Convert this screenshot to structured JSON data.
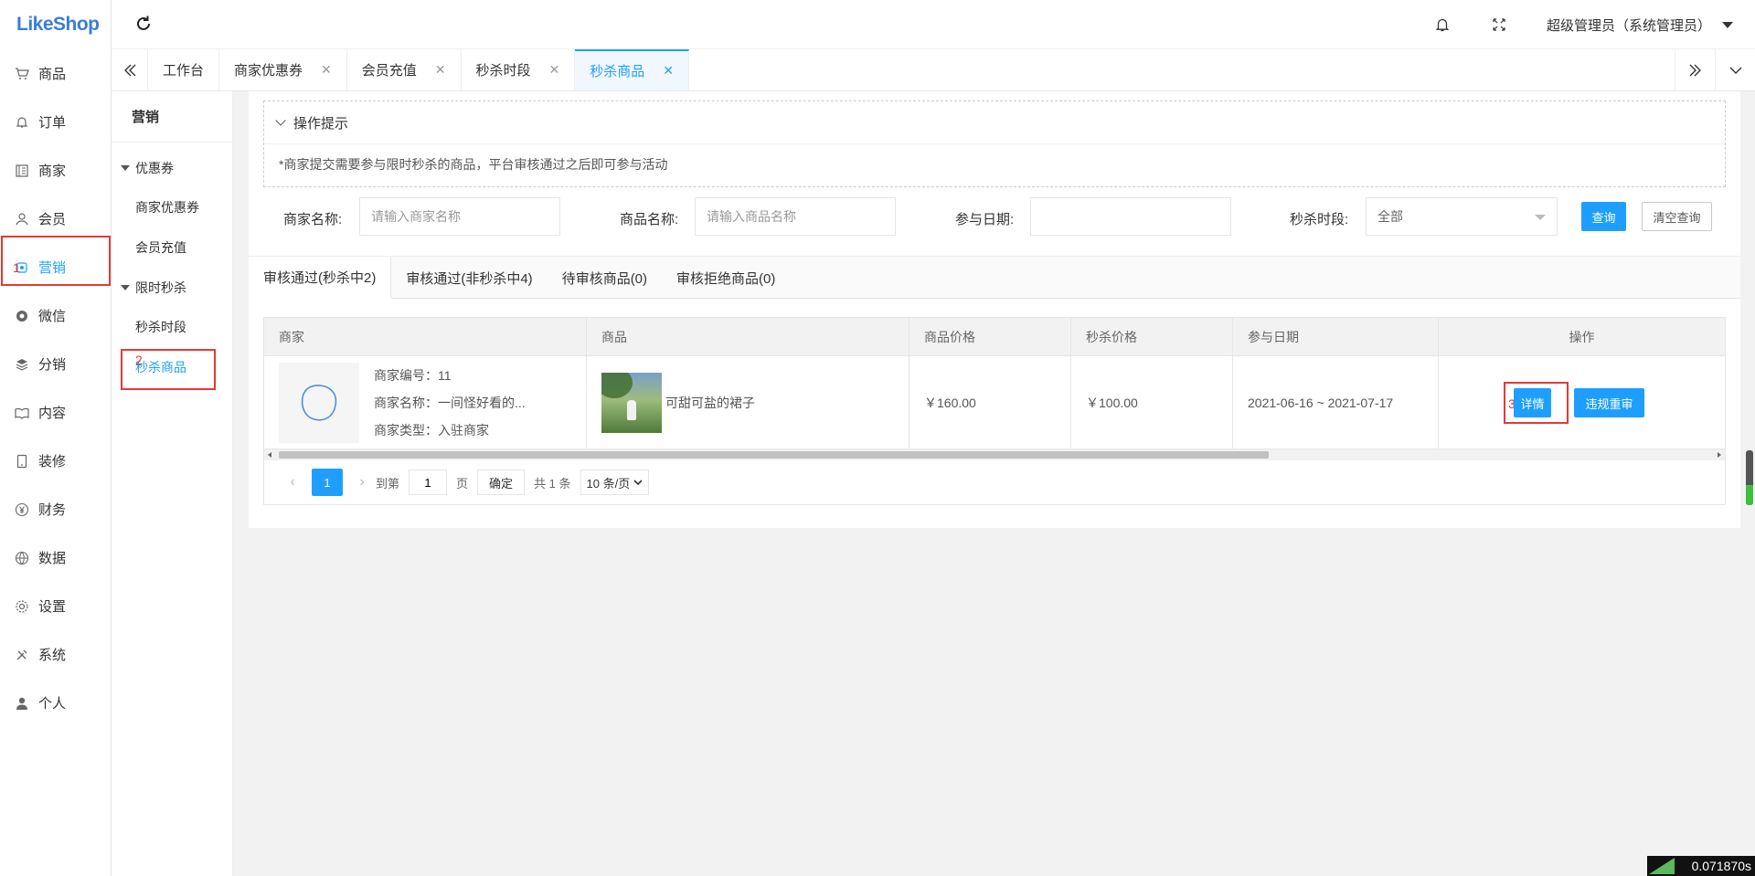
{
  "app": {
    "logo": "LikeShop"
  },
  "sidebar": {
    "items": [
      {
        "label": "商品",
        "icon": "cart-icon"
      },
      {
        "label": "订单",
        "icon": "bell-icon"
      },
      {
        "label": "商家",
        "icon": "store-icon"
      },
      {
        "label": "会员",
        "icon": "user-icon"
      },
      {
        "label": "营销",
        "icon": "marketing-icon",
        "mark": "1"
      },
      {
        "label": "微信",
        "icon": "wechat-icon"
      },
      {
        "label": "分销",
        "icon": "layers-icon"
      },
      {
        "label": "内容",
        "icon": "book-icon"
      },
      {
        "label": "装修",
        "icon": "tablet-icon"
      },
      {
        "label": "财务",
        "icon": "yen-icon"
      },
      {
        "label": "数据",
        "icon": "globe-icon"
      },
      {
        "label": "设置",
        "icon": "gear-icon"
      },
      {
        "label": "系统",
        "icon": "tools-icon"
      },
      {
        "label": "个人",
        "icon": "person-icon"
      }
    ]
  },
  "header": {
    "user": "超级管理员（系统管理员）"
  },
  "tabs": [
    {
      "label": "工作台"
    },
    {
      "label": "商家优惠券"
    },
    {
      "label": "会员充值"
    },
    {
      "label": "秒杀时段"
    },
    {
      "label": "秒杀商品"
    }
  ],
  "subside": {
    "title": "营销",
    "group1": "优惠券",
    "g1_items": [
      "商家优惠券",
      "会员充值"
    ],
    "group2": "限时秒杀",
    "g2_items": [
      "秒杀时段",
      "秒杀商品"
    ],
    "mark2": "2"
  },
  "tips": {
    "title": "操作提示",
    "body": "*商家提交需要参与限时秒杀的商品，平台审核通过之后即可参与活动"
  },
  "filter": {
    "merchant_label": "商家名称:",
    "merchant_ph": "请输入商家名称",
    "goods_label": "商品名称:",
    "goods_ph": "请输入商品名称",
    "date_label": "参与日期:",
    "slot_label": "秒杀时段:",
    "slot_value": "全部",
    "query": "查询",
    "clear": "清空查询"
  },
  "card_tabs": [
    "审核通过(秒杀中2)",
    "审核通过(非秒杀中4)",
    "待审核商品(0)",
    "审核拒绝商品(0)"
  ],
  "table": {
    "headers": [
      "商家",
      "商品",
      "商品价格",
      "秒杀价格",
      "参与日期",
      "操作"
    ],
    "row": {
      "m_no": "商家编号：11",
      "m_name": "商家名称：一间怪好看的...",
      "m_type": "商家类型：入驻商家",
      "goods": "可甜可盐的裙子",
      "price": "￥160.00",
      "seckill": "￥100.00",
      "date": "2021-06-16 ~ 2021-07-17",
      "btn_detail": "详情",
      "btn_review": "违规重审",
      "mark3": "3"
    }
  },
  "pager": {
    "page": "1",
    "goto": "到第",
    "page_input": "1",
    "page_unit": "页",
    "confirm": "确定",
    "total": "共 1 条",
    "size": "10 条/页"
  },
  "timer": "0.071870s"
}
